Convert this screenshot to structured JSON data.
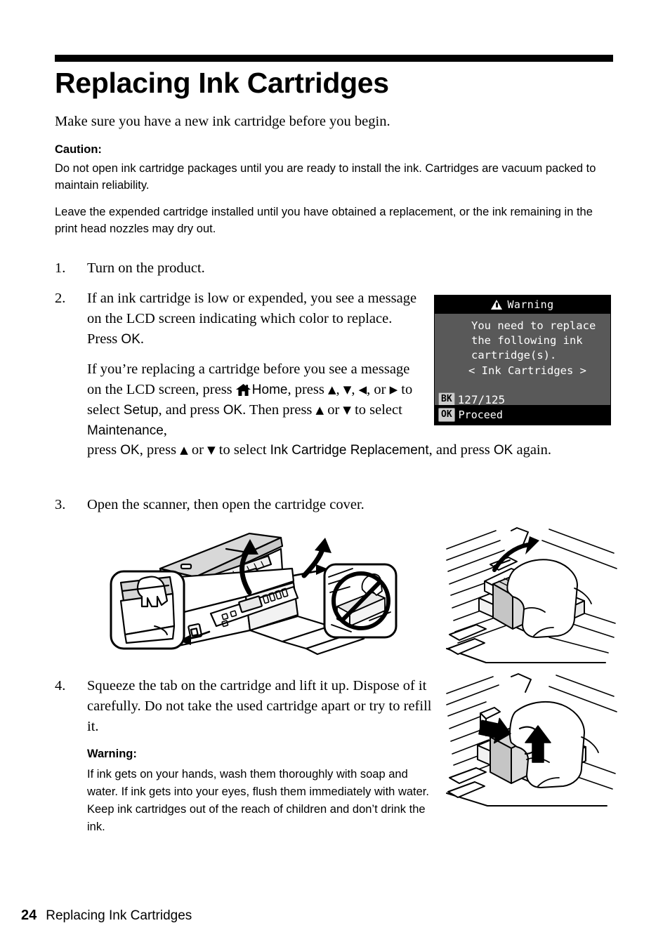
{
  "document": {
    "title": "Replacing Ink Cartridges",
    "intro": "Make sure you have a new ink cartridge before you begin."
  },
  "caution": {
    "heading": "Caution:",
    "paragraph1": "Do not open ink cartridge packages until you are ready to install the ink. Cartridges are vacuum packed to maintain reliability.",
    "paragraph2": "Leave the expended cartridge installed until you have obtained a replacement, or the ink remaining in the print head nozzles may dry out."
  },
  "steps": {
    "one": {
      "number": "1.",
      "text": "Turn on the product."
    },
    "two": {
      "number": "2.",
      "para1_a": "If an ink cartridge is low or expended, you see a message on the LCD screen indicating which color to replace. Press ",
      "para1_ok": "OK",
      "para1_b": ".",
      "para2_a": "If you’re replacing a cartridge before you see a message on the LCD screen, press ",
      "para2_home": "Home",
      "para2_b": ", press ",
      "arrow_up": "▲",
      "arrow_down": "▼",
      "arrow_left": "◀",
      "arrow_right": "▶",
      "para2_c": ", or ",
      "para2_d": " to select ",
      "para2_setup": "Setup",
      "para2_e": ", and press ",
      "para2_ok1": "OK",
      "para2_f": ". Then press ",
      "para2_g": " or ",
      "para2_h": " to select ",
      "para2_maint": "Maintenance",
      "para2_i": ",",
      "para3_a": "press ",
      "para3_ok": "OK",
      "para3_b": ", press ",
      "para3_c": " or ",
      "para3_d": " to select ",
      "para3_icr": "Ink Cartridge Replacement",
      "para3_e": ", and press ",
      "para3_ok2": "OK",
      "para3_f": " again."
    },
    "three": {
      "number": "3.",
      "text": "Open the scanner, then open the cartridge cover."
    },
    "four": {
      "number": "4.",
      "text": "Squeeze the tab on the cartridge and lift it up. Dispose of it carefully. Do not take the used cartridge apart or try to refill it."
    }
  },
  "warning": {
    "heading": "Warning:",
    "body": "If ink gets on your hands, wash them thoroughly with soap and water. If ink gets into your eyes, flush them immediately with water. Keep ink cartridges out of the reach of children and don’t drink the ink."
  },
  "lcd": {
    "title": "Warning",
    "message_line1": "You need to replace",
    "message_line2": "the following ink",
    "message_line3": "cartridge(s).",
    "cartridges_header": "< Ink Cartridges >",
    "ink_badge": "BK",
    "ink_number": "127/125",
    "ok_badge": "OK",
    "ok_label": "Proceed",
    "colors": {
      "screen_bg": "#595959",
      "bar_bg": "#000000",
      "text": "#ffffff",
      "badge_bg": "#cccccc"
    }
  },
  "illustrations": {
    "scanner": "printer-scanner-open-line-art",
    "cover": "cartridge-cover-open-line-art",
    "squeeze": "squeeze-cartridge-tab-line-art"
  },
  "footer": {
    "page_number": "24",
    "section": "Replacing Ink Cartridges"
  }
}
